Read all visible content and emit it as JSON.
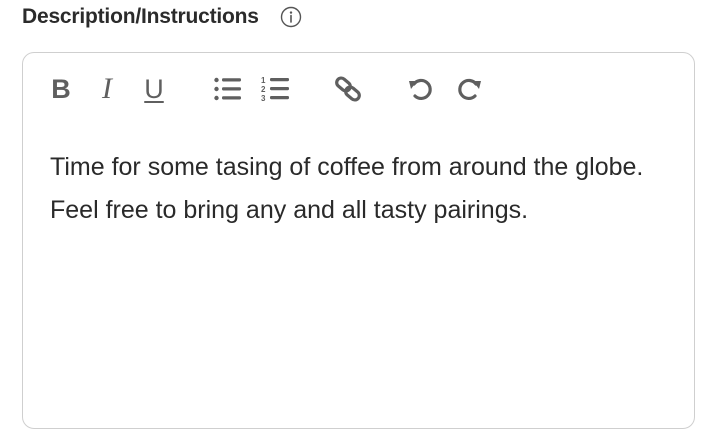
{
  "field": {
    "label": "Description/Instructions",
    "info_icon": "info-circle-icon"
  },
  "toolbar": {
    "bold_label": "B",
    "italic_label": "I",
    "underline_label": "U",
    "icons": [
      "bold-icon",
      "italic-icon",
      "underline-icon",
      "bulleted-list-icon",
      "numbered-list-icon",
      "link-icon",
      "undo-icon",
      "redo-icon"
    ],
    "icon_color": "#5f5f5f"
  },
  "editor": {
    "content": "Time for some tasing of coffee from around the globe. Feel free to bring any and all tasty pairings.",
    "border_color": "#cfcfcf"
  }
}
